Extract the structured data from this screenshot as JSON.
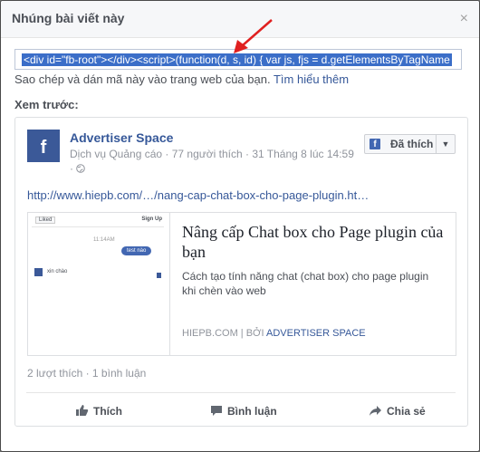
{
  "dialog": {
    "title": "Nhúng bài viết này",
    "close_label": "×",
    "embed_code": "<div id=\"fb-root\"></div><script>(function(d, s, id) {  var js, fjs = d.getElementsByTagName",
    "hint_text": "Sao chép và dán mã này vào trang web của bạn.",
    "learn_more": "Tìm hiểu thêm",
    "preview_label": "Xem trước:"
  },
  "post": {
    "page_logo": "f",
    "page_name": "Advertiser Space",
    "meta": "Dịch vụ Quảng cáo · 77 người thích · 31 Tháng 8 lúc 14:59",
    "globe_line": "·",
    "liked_label": "Đã thích",
    "link_text": "http://www.hiepb.com/…/nang-cap-chat-box-cho-page-plugin.ht…",
    "attachment": {
      "title": "Nâng cấp Chat box cho Page plugin của bạn",
      "description": "Cách tạo tính năng chat (chat box) cho page plugin khi chèn vào web",
      "source": "HIEPB.COM",
      "source_sep": "|",
      "by_prefix": "BỞI",
      "by_name": "ADVERTISER SPACE",
      "thumb": {
        "liked": "Liked",
        "signup": "Sign Up",
        "time": "11:14AM",
        "bubble": "test nào",
        "msg": "xin chào"
      }
    },
    "stats": "2 lượt thích · 1 bình luận",
    "actions": {
      "like": "Thích",
      "comment": "Bình luận",
      "share": "Chia sẻ"
    }
  },
  "colors": {
    "fb_blue": "#3b5998",
    "link_blue": "#365899",
    "selection": "#3b6ec8",
    "annotation_arrow": "#e02020"
  }
}
